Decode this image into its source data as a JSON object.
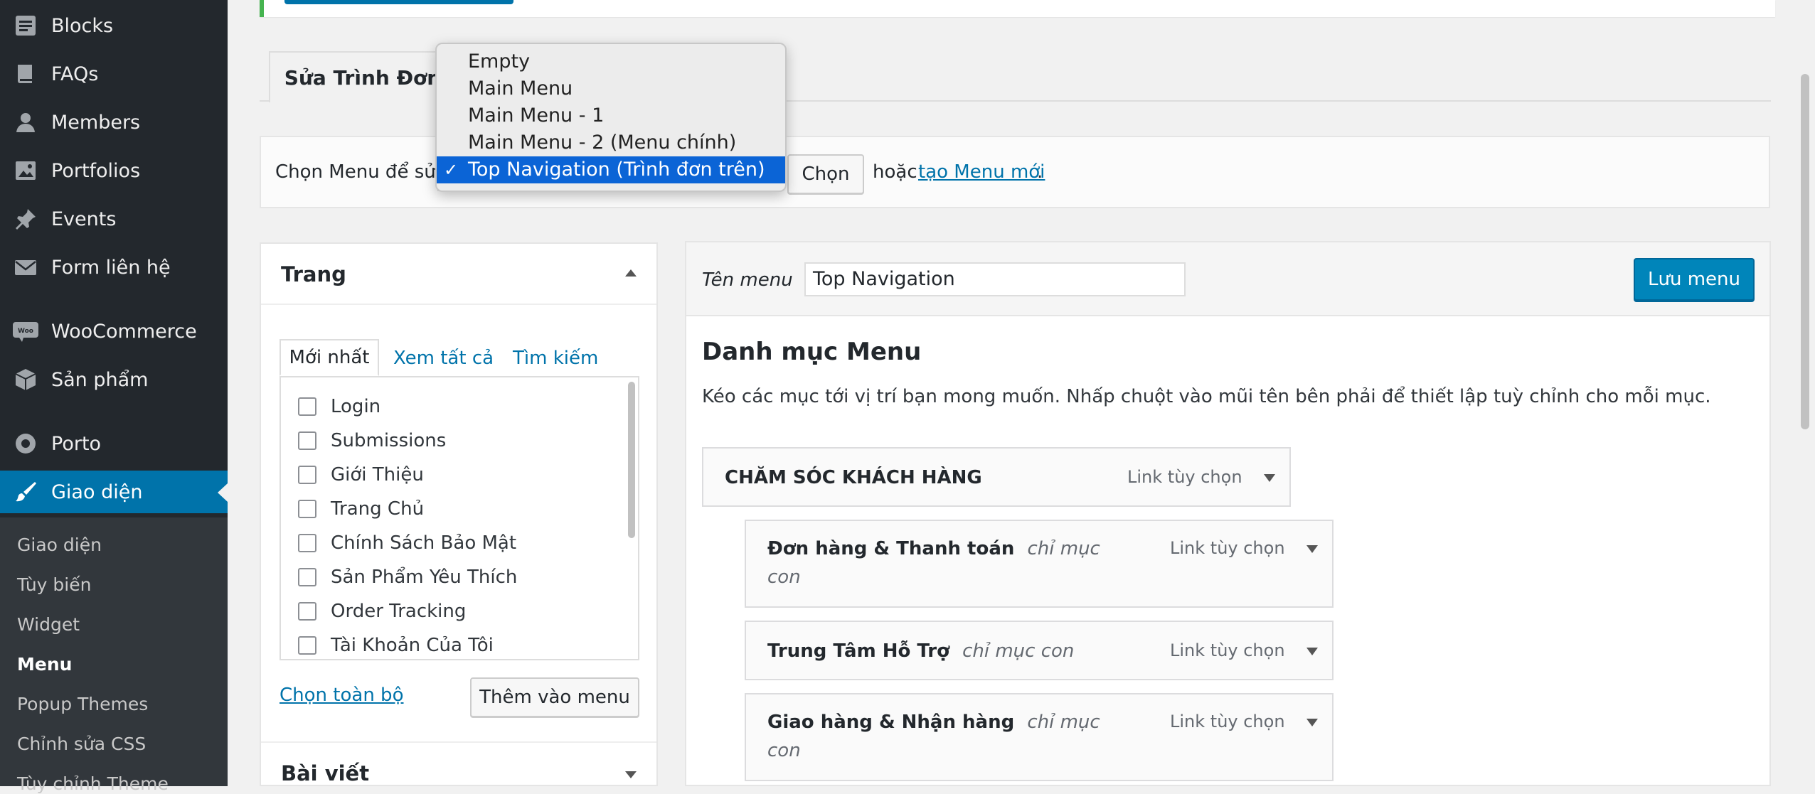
{
  "sidebar": {
    "items": [
      {
        "label": "Blocks",
        "icon": "blocks-icon"
      },
      {
        "label": "FAQs",
        "icon": "book-icon"
      },
      {
        "label": "Members",
        "icon": "person-icon"
      },
      {
        "label": "Portfolios",
        "icon": "image-icon"
      },
      {
        "label": "Events",
        "icon": "pin-icon"
      },
      {
        "label": "Form liên hệ",
        "icon": "mail-icon"
      },
      {
        "label": "WooCommerce",
        "icon": "woocommerce-icon"
      },
      {
        "label": "Sản phẩm",
        "icon": "cube-icon"
      },
      {
        "label": "Porto",
        "icon": "porto-icon"
      },
      {
        "label": "Giao diện",
        "icon": "paintbrush-icon"
      }
    ],
    "submenu": [
      "Giao diện",
      "Tùy biến",
      "Widget",
      "Menu",
      "Popup Themes",
      "Chỉnh sửa CSS",
      "Tùy chỉnh Theme"
    ],
    "current_submenu": "Menu"
  },
  "tabs": {
    "edit": "Sửa Trình Đơn"
  },
  "choose": {
    "label": "Chọn Menu để sửa",
    "button": "Chọn",
    "or": "hoặc",
    "create_link": "tạo Menu mới",
    "dot": "."
  },
  "dropdown": {
    "options": [
      "Empty",
      "Main Menu",
      "Main Menu - 1",
      "Main Menu - 2 (Menu chính)",
      "Top Navigation (Trình đơn trên)"
    ],
    "selected": "Top Navigation (Trình đơn trên)",
    "check": "✓"
  },
  "pages_panel": {
    "title": "Trang",
    "tabs": [
      "Mới nhất",
      "Xem tất cả",
      "Tìm kiếm"
    ],
    "items": [
      "Login",
      "Submissions",
      "Giới Thiệu",
      "Trang Chủ",
      "Chính Sách Bảo Mật",
      "Sản Phẩm Yêu Thích",
      "Order Tracking",
      "Tài Khoản Của Tôi"
    ],
    "select_all": "Chọn toàn bộ",
    "add_button": "Thêm vào menu"
  },
  "posts_panel": {
    "title": "Bài viết"
  },
  "menu_edit": {
    "name_label": "Tên menu",
    "name_value": "Top Navigation",
    "save_button": "Lưu menu",
    "section_title": "Danh mục Menu",
    "description": "Kéo các mục tới vị trí bạn mong muốn. Nhấp chuột vào mũi tên bên phải để thiết lập tuỳ chỉnh cho mỗi mục.",
    "items": [
      {
        "title": "CHĂM SÓC KHÁCH HÀNG",
        "sub": "",
        "type": "Link tùy chọn"
      },
      {
        "title": "Đơn hàng & Thanh toán",
        "sub": "chỉ mục",
        "sub2": "con",
        "type": "Link tùy chọn"
      },
      {
        "title": "Trung Tâm Hỗ Trợ",
        "sub": "chỉ mục con",
        "type": "Link tùy chọn"
      },
      {
        "title": "Giao hàng & Nhận hàng",
        "sub": "chỉ mục",
        "sub2": "con",
        "type": "Link tùy chọn"
      }
    ]
  },
  "colors": {
    "accent": "#0073aa",
    "sidebar_bg": "#23282d",
    "highlight": "#0b64d6"
  }
}
